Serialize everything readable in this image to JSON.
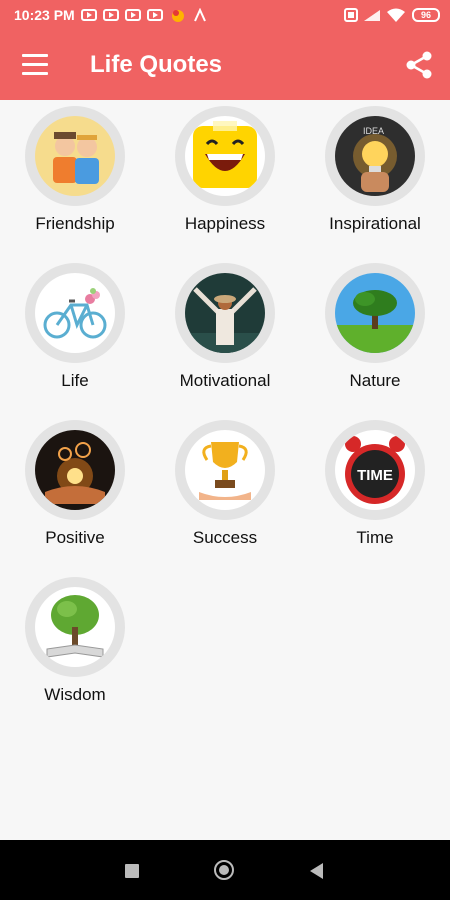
{
  "status_bar": {
    "time": "10:23 PM",
    "battery": "96"
  },
  "app_bar": {
    "title": "Life Quotes",
    "menu_icon": "hamburger-menu-icon",
    "share_icon": "share-icon"
  },
  "categories": [
    {
      "label": "Friendship",
      "icon": "friends-illustration"
    },
    {
      "label": "Happiness",
      "icon": "smiley-face"
    },
    {
      "label": "Inspirational",
      "icon": "lightbulb-idea"
    },
    {
      "label": "Life",
      "icon": "bicycle"
    },
    {
      "label": "Motivational",
      "icon": "person-arms-raised"
    },
    {
      "label": "Nature",
      "icon": "tree-landscape"
    },
    {
      "label": "Positive",
      "icon": "glowing-hands"
    },
    {
      "label": "Success",
      "icon": "trophy"
    },
    {
      "label": "Time",
      "icon": "alarm-clock"
    },
    {
      "label": "Wisdom",
      "icon": "tree-book"
    }
  ],
  "colors": {
    "primary": "#f06262",
    "background": "#f7f7f7",
    "ring": "#e3e3e3"
  }
}
